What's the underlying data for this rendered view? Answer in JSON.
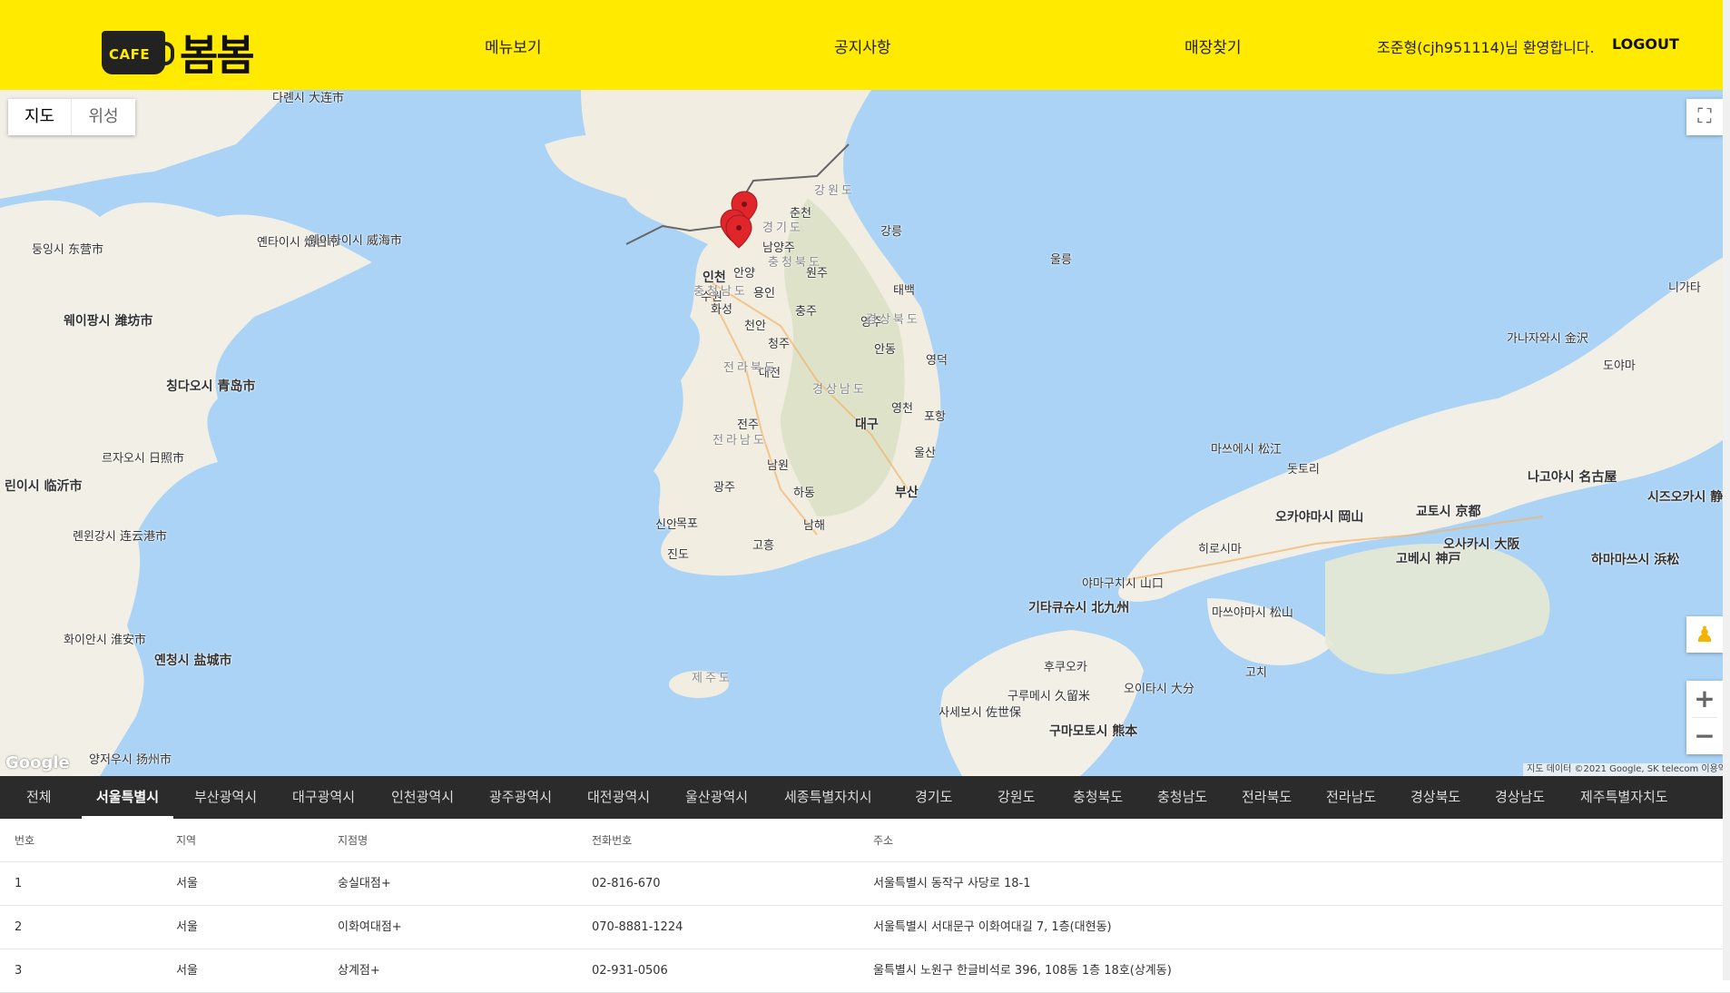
{
  "header": {
    "logo_cup_text": "CAFE",
    "logo_text": "봄봄",
    "nav": [
      "메뉴보기",
      "공지사항",
      "매장찾기"
    ],
    "greeting": "조준형(cjh951114)님 환영합니다.",
    "logout": "LOGOUT"
  },
  "map": {
    "type_buttons": [
      "지도",
      "위성"
    ],
    "google_label": "Google",
    "attribution": "지도 데이터 ©2021 Google, SK telecom  이용약",
    "labels": [
      "다롄시 大连市",
      "옌타이시 烟台市",
      "웨이하이시 威海市",
      "둥잉시 东营市",
      "웨이팡시 潍坊市",
      "칭다오시 青岛市",
      "르자오시 日照市",
      "린이시 临沂市",
      "롄윈강시 连云港市",
      "화이안시 淮安市",
      "옌청시 盐城市",
      "양저우시 扬州市",
      "인천",
      "수원",
      "용인",
      "안양",
      "남양주",
      "춘천",
      "원주",
      "강릉",
      "태백",
      "충주",
      "천안",
      "청주",
      "대전",
      "영주",
      "안동",
      "영덕",
      "전주",
      "대구",
      "포항",
      "울산",
      "부산",
      "광주",
      "목포",
      "신안",
      "진도",
      "화성",
      "남원",
      "하동",
      "남해",
      "고흥",
      "영천",
      "강원도",
      "경기도",
      "충청북도",
      "충청남도",
      "경상북도",
      "전라북도",
      "경상남도",
      "전라남도",
      "제주도",
      "울릉",
      "마쓰에시 松江",
      "돗토리",
      "오카야마시 岡山",
      "고베시 神戸",
      "오사카시 大阪",
      "교토시 京都",
      "나고야시 名古屋",
      "시즈오카시 静岡",
      "하마마쓰시 浜松",
      "가나자와시 金沢",
      "기타큐슈시 北九州",
      "구루메시 久留米",
      "구마모토시 熊本",
      "오이타시 大分",
      "마쓰야마시 松山",
      "고치",
      "후쿠오카",
      "사세보시 佐世保",
      "야마구치시 山口",
      "히로시마",
      "니가타",
      "도야마"
    ]
  },
  "tabs": [
    "전체",
    "서울특별시",
    "부산광역시",
    "대구광역시",
    "인천광역시",
    "광주광역시",
    "대전광역시",
    "울산광역시",
    "세종특별자치시",
    "경기도",
    "강원도",
    "충청북도",
    "충청남도",
    "전라북도",
    "전라남도",
    "경상북도",
    "경상남도",
    "제주특별자치도"
  ],
  "active_tab": "서울특별시",
  "table": {
    "headers": [
      "번호",
      "지역",
      "지점명",
      "전화번호",
      "주소"
    ],
    "rows": [
      [
        "1",
        "서울",
        "숭실대점+",
        "02-816-670",
        "서울특별시 동작구 사당로 18-1"
      ],
      [
        "2",
        "서울",
        "이화여대점+",
        "070-8881-1224",
        "서울특별시 서대문구 이화여대길 7, 1층(대현동)"
      ],
      [
        "3",
        "서울",
        "상계점+",
        "02-931-0506",
        "울특별시 노원구 한글비석로 396, 108동 1층 18호(상계동)"
      ]
    ]
  },
  "colors": {
    "header_bg": "#ffea00",
    "tab_bg": "#2b2b2b",
    "sea": "#abd3f5",
    "land": "#f2efe6",
    "marker": "#e0262b"
  }
}
